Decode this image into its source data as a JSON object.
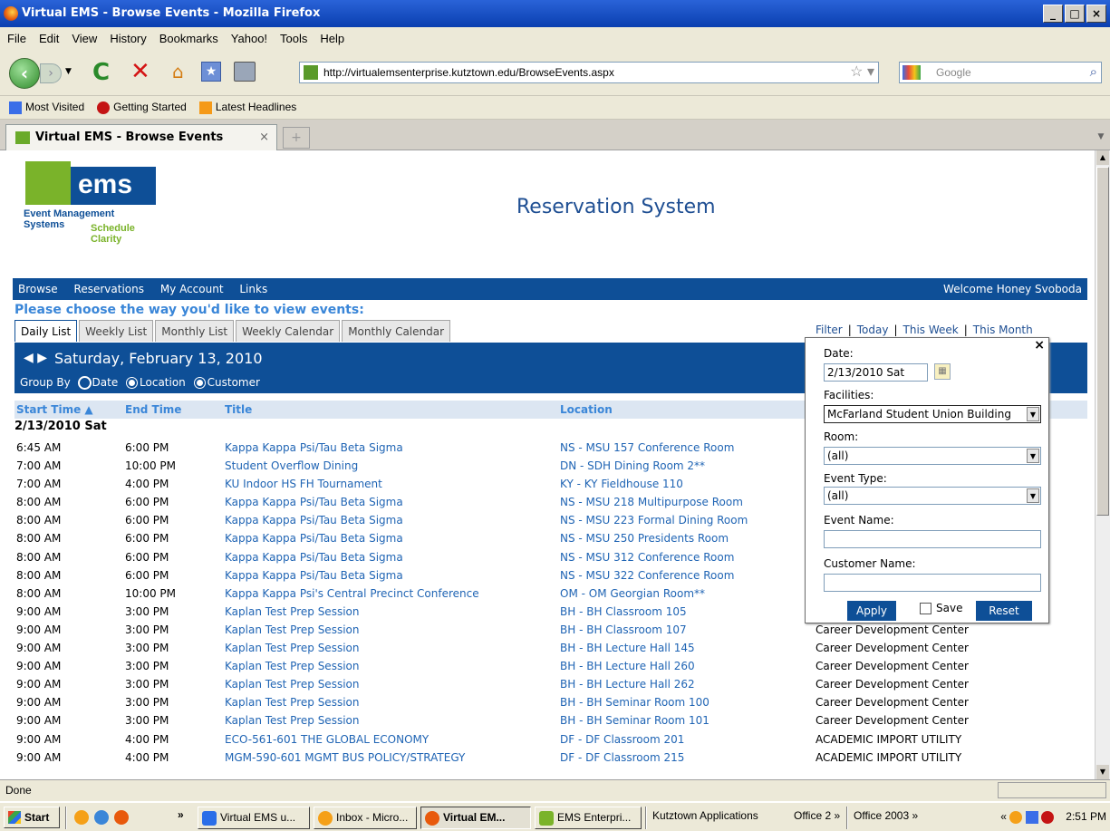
{
  "window": {
    "title": "Virtual EMS - Browse Events - Mozilla Firefox",
    "controls": [
      "_",
      "□",
      "×"
    ]
  },
  "menu": [
    "File",
    "Edit",
    "View",
    "History",
    "Bookmarks",
    "Yahoo!",
    "Tools",
    "Help"
  ],
  "nav": {
    "url": "http://virtualemsenterprise.kutztown.edu/BrowseEvents.aspx",
    "search_placeholder": "Google"
  },
  "bookmarks": [
    "Most Visited",
    "Getting Started",
    "Latest Headlines"
  ],
  "tabs": [
    {
      "label": "Virtual EMS - Browse Events"
    }
  ],
  "page": {
    "logo": {
      "word": "ems",
      "line1": "Event Management Systems",
      "line2": "Schedule Clarity"
    },
    "heading": "Reservation System",
    "nav_items": [
      "Browse",
      "Reservations",
      "My Account",
      "Links"
    ],
    "welcome": "Welcome Honey Svoboda",
    "prompt": "Please choose the way you'd like to view events:",
    "view_tabs": [
      "Daily List",
      "Weekly List",
      "Monthly List",
      "Weekly Calendar",
      "Monthly Calendar"
    ],
    "filter_links": [
      "Filter",
      "Today",
      "This Week",
      "This Month"
    ],
    "current_date": "Saturday, February 13, 2010",
    "group_by": {
      "label": "Group By",
      "options": [
        "Date",
        "Location",
        "Customer"
      ],
      "selected": "Date"
    },
    "columns": [
      "Start Time ▲",
      "End Time",
      "Title",
      "Location"
    ],
    "date_group": "2/13/2010 Sat",
    "events": [
      {
        "start": "6:45 AM",
        "end": "6:00 PM",
        "title": "Kappa Kappa Psi/Tau Beta Sigma",
        "location": "NS - MSU 157 Conference Room",
        "customer": ""
      },
      {
        "start": "7:00 AM",
        "end": "10:00 PM",
        "title": "Student Overflow Dining",
        "location": "DN - SDH Dining Room 2**",
        "customer": ""
      },
      {
        "start": "7:00 AM",
        "end": "4:00 PM",
        "title": "KU Indoor HS FH Tournament",
        "location": "KY - KY Fieldhouse 110",
        "customer": ""
      },
      {
        "start": "8:00 AM",
        "end": "6:00 PM",
        "title": "Kappa Kappa Psi/Tau Beta Sigma",
        "location": "NS - MSU 218 Multipurpose Room",
        "customer": ""
      },
      {
        "start": "8:00 AM",
        "end": "6:00 PM",
        "title": "Kappa Kappa Psi/Tau Beta Sigma",
        "location": "NS - MSU 223 Formal Dining Room",
        "customer": ""
      },
      {
        "start": "8:00 AM",
        "end": "6:00 PM",
        "title": "Kappa Kappa Psi/Tau Beta Sigma",
        "location": "NS - MSU 250 Presidents Room",
        "customer": ""
      },
      {
        "start": "8:00 AM",
        "end": "6:00 PM",
        "title": "Kappa Kappa Psi/Tau Beta Sigma",
        "location": "NS - MSU 312 Conference Room",
        "customer": ""
      },
      {
        "start": "8:00 AM",
        "end": "6:00 PM",
        "title": "Kappa Kappa Psi/Tau Beta Sigma",
        "location": "NS - MSU 322 Conference Room",
        "customer": ""
      },
      {
        "start": "8:00 AM",
        "end": "10:00 PM",
        "title": "Kappa Kappa Psi's Central Precinct Conference",
        "location": "OM - OM Georgian Room**",
        "customer": ""
      },
      {
        "start": "9:00 AM",
        "end": "3:00 PM",
        "title": "Kaplan Test Prep Session",
        "location": "BH - BH Classroom 105",
        "customer": ""
      },
      {
        "start": "9:00 AM",
        "end": "3:00 PM",
        "title": "Kaplan Test Prep Session",
        "location": "BH - BH Classroom 107",
        "customer": "Career Development Center"
      },
      {
        "start": "9:00 AM",
        "end": "3:00 PM",
        "title": "Kaplan Test Prep Session",
        "location": "BH - BH Lecture Hall 145",
        "customer": "Career Development Center"
      },
      {
        "start": "9:00 AM",
        "end": "3:00 PM",
        "title": "Kaplan Test Prep Session",
        "location": "BH - BH Lecture Hall 260",
        "customer": "Career Development Center"
      },
      {
        "start": "9:00 AM",
        "end": "3:00 PM",
        "title": "Kaplan Test Prep Session",
        "location": "BH - BH Lecture Hall 262",
        "customer": "Career Development Center"
      },
      {
        "start": "9:00 AM",
        "end": "3:00 PM",
        "title": "Kaplan Test Prep Session",
        "location": "BH - BH Seminar Room 100",
        "customer": "Career Development Center"
      },
      {
        "start": "9:00 AM",
        "end": "3:00 PM",
        "title": "Kaplan Test Prep Session",
        "location": "BH - BH Seminar Room 101",
        "customer": "Career Development Center"
      },
      {
        "start": "9:00 AM",
        "end": "4:00 PM",
        "title": "ECO-561-601 THE GLOBAL ECONOMY",
        "location": "DF - DF Classroom 201",
        "customer": "ACADEMIC IMPORT UTILITY"
      },
      {
        "start": "9:00 AM",
        "end": "4:00 PM",
        "title": "MGM-590-601 MGMT BUS POLICY/STRATEGY",
        "location": "DF - DF Classroom 215",
        "customer": "ACADEMIC IMPORT UTILITY"
      }
    ],
    "filter": {
      "date_label": "Date:",
      "date_value": "2/13/2010 Sat",
      "facilities_label": "Facilities:",
      "facilities_value": "McFarland Student Union Building",
      "room_label": "Room:",
      "room_value": "(all)",
      "event_type_label": "Event Type:",
      "event_type_value": "(all)",
      "event_name_label": "Event Name:",
      "event_name_value": "",
      "customer_name_label": "Customer Name:",
      "customer_name_value": "",
      "apply": "Apply",
      "save": "Save",
      "reset": "Reset"
    }
  },
  "status": "Done",
  "taskbar": {
    "start": "Start",
    "items": [
      "Virtual EMS u...",
      "Inbox - Micro...",
      "Virtual EM...",
      "EMS Enterpri...",
      "Kutztown Applications",
      "Office 2 »",
      "Office 2003 »"
    ],
    "clock": "2:51 PM"
  },
  "colors": {
    "brand_blue": "#0e4f97",
    "link_blue": "#1f64b4",
    "ems_green": "#7ab32a"
  }
}
